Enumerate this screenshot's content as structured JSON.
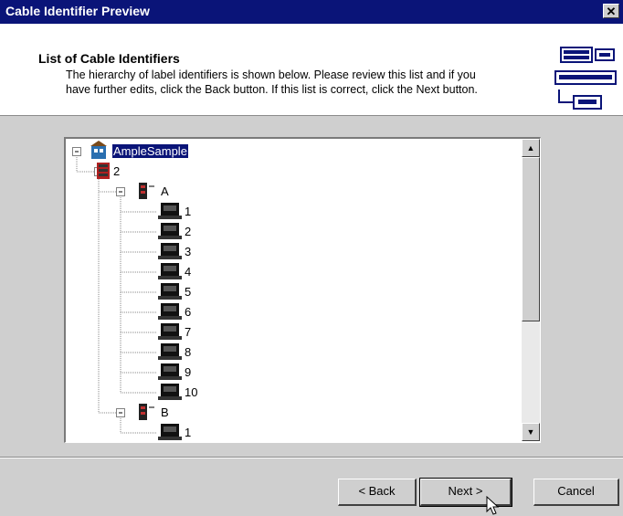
{
  "window": {
    "title": "Cable Identifier Preview",
    "close_label": "✕"
  },
  "header": {
    "title": "List of Cable Identifiers",
    "description_line1": "The hierarchy of label identifiers is shown below.  Please review this list and if you",
    "description_line2": "have further edits, click the Back button.  If this list is correct, click the Next button."
  },
  "tree": {
    "root": "AmpleSample",
    "level1": "2",
    "group_a": "A",
    "group_a_items": [
      "1",
      "2",
      "3",
      "4",
      "5",
      "6",
      "7",
      "8",
      "9",
      "10"
    ],
    "group_b": "B",
    "group_b_items": [
      "1"
    ]
  },
  "buttons": {
    "back": "< Back",
    "next": "Next >",
    "cancel": "Cancel"
  },
  "colors": {
    "titlebar": "#0a1478",
    "selection": "#0a1478"
  }
}
